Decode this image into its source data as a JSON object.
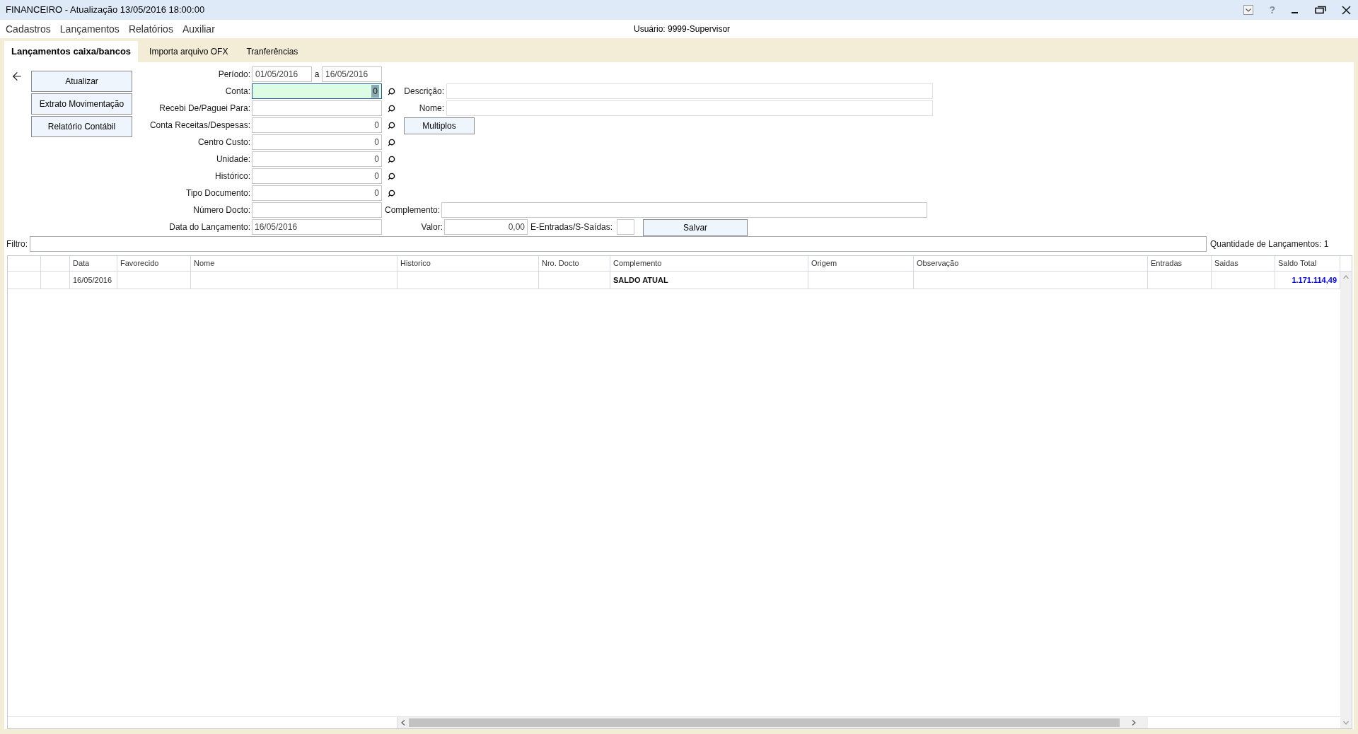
{
  "window": {
    "title": "FINANCEIRO - Atualização 13/05/2016 18:00:00",
    "help": "?"
  },
  "menu": [
    {
      "label": "Cadastros"
    },
    {
      "label": "Lançamentos"
    },
    {
      "label": "Relatórios"
    },
    {
      "label": "Auxiliar"
    }
  ],
  "user": "Usuário: 9999-Supervisor",
  "tabs": [
    {
      "label": "Lançamentos caixa/bancos",
      "selected": true
    },
    {
      "label": "Importa arquivo OFX",
      "selected": false
    },
    {
      "label": "Tranferências",
      "selected": false
    }
  ],
  "actions": [
    {
      "label": "Atualizar"
    },
    {
      "label": "Extrato Movimentação"
    },
    {
      "label": "Relatório Contábil"
    }
  ],
  "period": {
    "label": "Período:",
    "from": "01/05/2016",
    "separator": "a",
    "to": "16/05/2016"
  },
  "fields": [
    {
      "label": "Conta:",
      "value": "0",
      "kind": "number",
      "lookup": true,
      "focused": true
    },
    {
      "label": "Recebi De/Paguei Para:",
      "kind": "text",
      "lookup": true,
      "focused": false
    },
    {
      "label": "Conta Receitas/Despesas:",
      "value": "0",
      "kind": "number",
      "lookup": true,
      "focused": false
    },
    {
      "label": "Centro Custo:",
      "value": "0",
      "kind": "number",
      "lookup": true,
      "focused": false
    },
    {
      "label": "Unidade:",
      "value": "0",
      "kind": "number",
      "lookup": true,
      "focused": false
    },
    {
      "label": "Histórico:",
      "value": "0",
      "kind": "number",
      "lookup": true,
      "focused": false
    },
    {
      "label": "Tipo Documento:",
      "value": "0",
      "kind": "number",
      "lookup": true,
      "focused": false
    },
    {
      "label": "Número Docto:",
      "kind": "text",
      "lookup": false,
      "focused": false
    },
    {
      "label": "Data do Lançamento:",
      "value": "16/05/2016",
      "kind": "text",
      "lookup": false,
      "focused": false
    }
  ],
  "description": {
    "label": "Descrição:"
  },
  "name_field": {
    "label": "Nome:"
  },
  "multiples_button": "Multiplos",
  "complement": {
    "label": "Complemento:"
  },
  "amount": {
    "label": "Valor:",
    "value": "0,00"
  },
  "direction": {
    "label": "E-Entradas/S-Saídas:"
  },
  "save_button": "Salvar",
  "filter": {
    "label": "Filtro:"
  },
  "count": "Quantidade de Lançamentos: 1",
  "table": {
    "columns": [
      "Data",
      "Favorecido",
      "Nome",
      "Historico",
      "Nro. Docto",
      "Complemento",
      "Origem",
      "Observação",
      "Entradas",
      "Saidas",
      "Saldo Total"
    ],
    "rows": [
      {
        "cells": [
          {
            "text": "16/05/2016",
            "kind": "date"
          },
          null,
          null,
          null,
          null,
          {
            "text": "SALDO ATUAL",
            "kind": "heading"
          },
          null,
          null,
          null,
          null,
          {
            "text": "1.171.114,49",
            "kind": "total"
          }
        ]
      }
    ]
  }
}
